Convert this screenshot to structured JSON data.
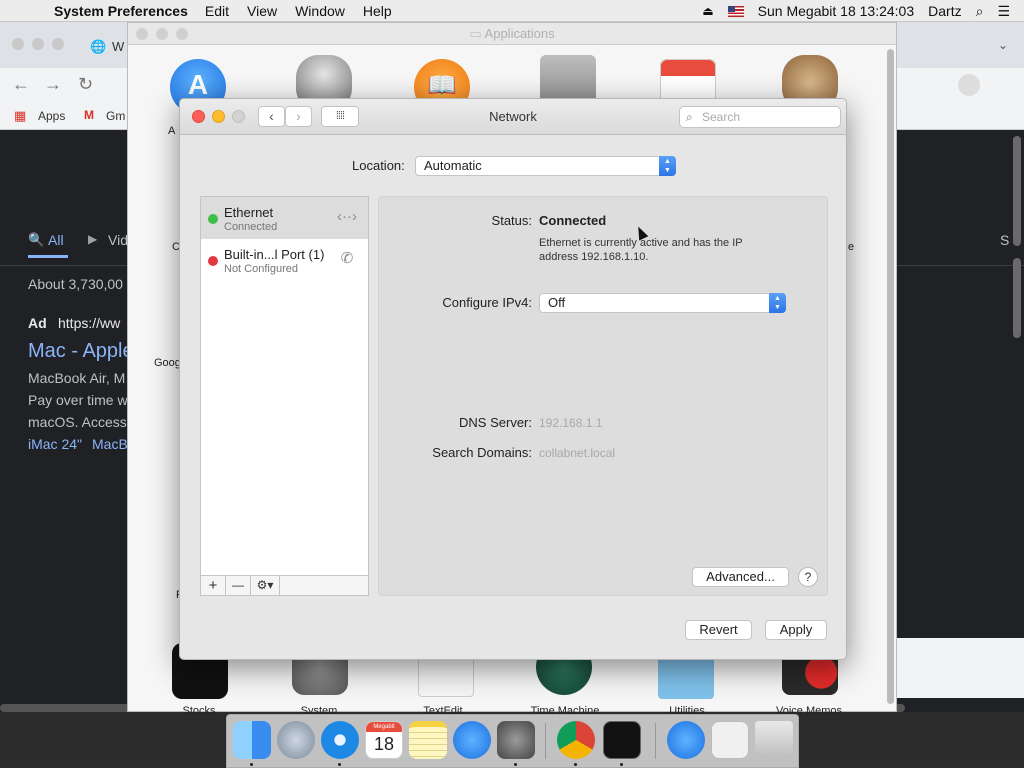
{
  "menubar": {
    "app_name": "System Preferences",
    "menus": [
      "Edit",
      "View",
      "Window",
      "Help"
    ],
    "datetime": "Sun Megabit 18  13:24:03",
    "user": "Dartz"
  },
  "browser": {
    "tab_title": "W",
    "bookmarks": {
      "apps": "Apps",
      "gmail": "Gm"
    },
    "search_tabs": {
      "all": "All",
      "videos": "Vid",
      "more": "S"
    },
    "results_count": "About 3,730,00",
    "ad_line": "https://ww",
    "ad_prefix": "Ad",
    "result_title": "Mac - Apple",
    "snippet": [
      "MacBook Air, M",
      "Pay over time w",
      "macOS. Access"
    ],
    "sitelinks": [
      "iMac 24\"",
      "MacB"
    ]
  },
  "finder": {
    "title": "Applications",
    "labels": {
      "a1": "A",
      "c1": "C",
      "google": "Goog",
      "p1": "P",
      "e1": "e",
      "stocks": "Stocks",
      "system": "System",
      "textedit": "TextEdit",
      "timemachine": "Time Machine",
      "utilities": "Utilities",
      "voicememos": "Voice Memos"
    }
  },
  "network": {
    "title": "Network",
    "search_placeholder": "Search",
    "location_label": "Location:",
    "location_value": "Automatic",
    "services": [
      {
        "name": "Ethernet",
        "status": "Connected",
        "dot": "#3cbf48"
      },
      {
        "name": "Built-in...l Port (1)",
        "status": "Not Configured",
        "dot": "#e0383e"
      }
    ],
    "status_label": "Status:",
    "status_value": "Connected",
    "status_desc": "Ethernet is currently active and has the IP address 192.168.1.10.",
    "ipv4_label": "Configure IPv4:",
    "ipv4_value": "Off",
    "dns_label": "DNS Server:",
    "dns_value": "192.168.1.1",
    "domains_label": "Search Domains:",
    "domains_value": "collabnet.local",
    "advanced_label": "Advanced...",
    "help_label": "?",
    "revert_label": "Revert",
    "apply_label": "Apply",
    "tools": {
      "add": "+",
      "remove": "—",
      "gear": "⚙▾"
    }
  },
  "dock": {
    "calendar_month": "Megabit",
    "calendar_day": "18"
  },
  "colors": {
    "accent": "#2b74e6",
    "connected": "#3cbf48",
    "not_configured": "#e0383e"
  }
}
